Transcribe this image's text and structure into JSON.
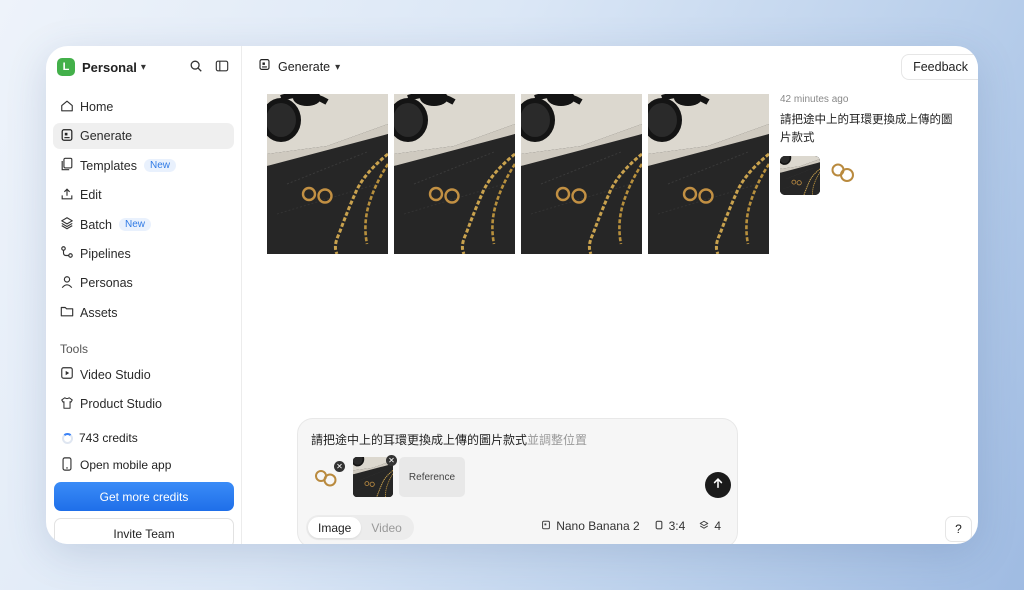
{
  "workspace": {
    "initial": "L",
    "name": "Personal"
  },
  "sidebar": {
    "items": [
      {
        "label": "Home",
        "icon": "home-icon"
      },
      {
        "label": "Generate",
        "icon": "image-frame-icon",
        "active": true
      },
      {
        "label": "Templates",
        "icon": "copy-icon",
        "badge": "New"
      },
      {
        "label": "Edit",
        "icon": "upload-icon"
      },
      {
        "label": "Batch",
        "icon": "layers-icon",
        "badge": "New"
      },
      {
        "label": "Pipelines",
        "icon": "flow-icon"
      },
      {
        "label": "Personas",
        "icon": "person-icon"
      },
      {
        "label": "Assets",
        "icon": "folder-icon"
      }
    ],
    "tools_label": "Tools",
    "tools": [
      {
        "label": "Video Studio",
        "icon": "play-square-icon"
      },
      {
        "label": "Product Studio",
        "icon": "tshirt-icon"
      }
    ],
    "credits": "743 credits",
    "mobile": "Open mobile app",
    "get_credits": "Get more credits",
    "invite": "Invite Team"
  },
  "header": {
    "title": "Generate",
    "feedback": "Feedback"
  },
  "result": {
    "time": "42 minutes ago",
    "prompt": "請把途中上的耳環更換成上傳的圖片款式",
    "image_count": 4
  },
  "composer": {
    "text": "請把途中上的耳環更換成上傳的圖片款式",
    "placeholder_tail": "並調整位置",
    "reference_label": "Reference",
    "modes": [
      "Image",
      "Video"
    ],
    "active_mode": "Image",
    "model": "Nano Banana 2",
    "ratio": "3:4",
    "count": "4"
  },
  "help": "?",
  "colors": {
    "accent": "#2f7ae5",
    "avatar": "#43b04a",
    "send": "#1b1b1b"
  }
}
